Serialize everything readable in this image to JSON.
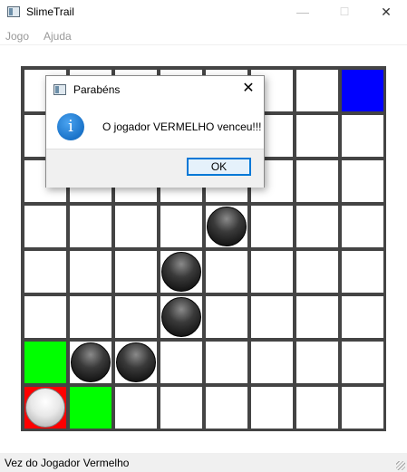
{
  "window": {
    "title": "SlimeTrail",
    "minimize_glyph": "—",
    "maximize_glyph": "☐",
    "close_glyph": "✕"
  },
  "menu": [
    {
      "label": "Jogo"
    },
    {
      "label": "Ajuda"
    }
  ],
  "board": {
    "size": 8,
    "colors": {
      "grid": "#444444",
      "empty": "#ffffff",
      "blue": "#0000ff",
      "green": "#00ff00",
      "red": "#ff0000"
    },
    "cells": [
      {
        "row": 0,
        "col": 7,
        "fill": "blue"
      },
      {
        "row": 6,
        "col": 0,
        "fill": "green"
      },
      {
        "row": 7,
        "col": 1,
        "fill": "green"
      },
      {
        "row": 7,
        "col": 0,
        "fill": "red"
      }
    ],
    "pieces": [
      {
        "row": 3,
        "col": 4,
        "type": "black"
      },
      {
        "row": 4,
        "col": 3,
        "type": "black"
      },
      {
        "row": 5,
        "col": 3,
        "type": "black"
      },
      {
        "row": 6,
        "col": 1,
        "type": "black"
      },
      {
        "row": 6,
        "col": 2,
        "type": "black"
      },
      {
        "row": 7,
        "col": 0,
        "type": "white"
      }
    ]
  },
  "dialog": {
    "title": "Parabéns",
    "message": "O jogador VERMELHO venceu!!!",
    "ok_label": "OK",
    "close_glyph": "✕",
    "info_glyph": "i"
  },
  "status": {
    "text": "Vez do Jogador Vermelho"
  }
}
